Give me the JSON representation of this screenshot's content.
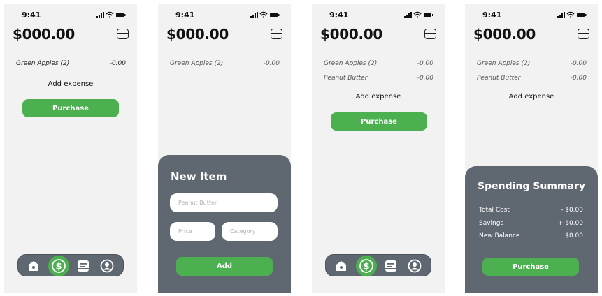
{
  "status": {
    "time": "9:41"
  },
  "balance": "$000.00",
  "add_expense": "Add expense",
  "purchase_label": "Purchase",
  "expenses": {
    "green_apples": {
      "name": "Green Apples (2)",
      "amount": "-0.00"
    },
    "peanut_butter": {
      "name": "Peanut Butter",
      "amount": "-0.00"
    }
  },
  "new_item": {
    "title": "New Item",
    "name_placeholder": "Peanut Butter",
    "price_placeholder": "Price",
    "category_placeholder": "Category",
    "add_label": "Add"
  },
  "summary": {
    "title": "Spending Summary",
    "total_cost": {
      "label": "Total Cost",
      "value": "- $0.00"
    },
    "savings": {
      "label": "Savings",
      "value": "+ $0.00"
    },
    "new_balance": {
      "label": "New Balance",
      "value": "$0.00"
    }
  },
  "nav": [
    "home-icon",
    "dollar-icon",
    "list-icon",
    "profile-icon"
  ],
  "colors": {
    "accent": "#4caf50",
    "sheet": "#5f6771",
    "screen_bg": "#f2f2f2"
  }
}
